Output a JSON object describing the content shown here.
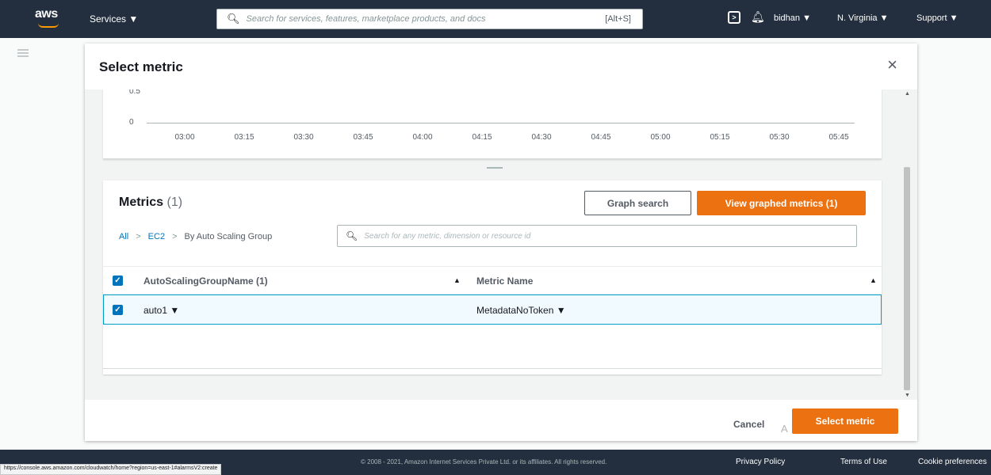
{
  "topnav": {
    "logo": "aws",
    "services_label": "Services ▼",
    "search_placeholder": "Search for services, features, marketplace products, and docs",
    "search_shortcut": "[Alt+S]",
    "cloudshell_icon": "cloudshell-icon",
    "bell_icon": "bell-icon",
    "user": "bidhan ▼",
    "region": "N. Virginia ▼",
    "support": "Support ▼"
  },
  "modal": {
    "title": "Select metric",
    "close_icon": "×",
    "cancel_label": "Cancel",
    "select_label": "Select metric"
  },
  "chart_data": {
    "type": "line",
    "y_tick_labels": [
      "0.5",
      "0"
    ],
    "x_tick_labels": [
      "03:00",
      "03:15",
      "03:30",
      "03:45",
      "04:00",
      "04:15",
      "04:30",
      "04:45",
      "05:00",
      "05:15",
      "05:30",
      "05:45"
    ],
    "series": []
  },
  "metrics": {
    "title": "Metrics",
    "count": "(1)",
    "graph_search_label": "Graph search",
    "view_graphed_label": "View graphed metrics (1)",
    "breadcrumb": {
      "all": "All",
      "ec2": "EC2",
      "group": "By Auto Scaling Group",
      "separator": ">"
    },
    "search_placeholder": "Search for any metric, dimension or resource id",
    "columns": [
      "AutoScalingGroupName (1)",
      "Metric Name"
    ],
    "rows": [
      {
        "group": "auto1 ▼",
        "metric": "MetadataNoToken ▼"
      }
    ]
  },
  "footer": {
    "copyright": "© 2008 - 2021, Amazon Internet Services Private Ltd. or its affiliates. All rights reserved.",
    "privacy": "Privacy Policy",
    "terms": "Terms of Use",
    "cookies": "Cookie preferences",
    "status_url": "https://console.aws.amazon.com/cloudwatch/home?region=us-east-1#alarmsV2:create"
  },
  "colors": {
    "nav_bg": "#232f3e",
    "primary_orange": "#ec7211",
    "link_blue": "#0073bb"
  }
}
